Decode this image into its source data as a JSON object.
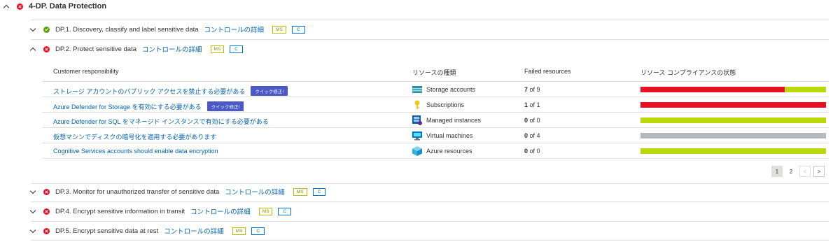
{
  "section": {
    "title": "4-DP. Data Protection"
  },
  "controls": [
    {
      "id": "dp1",
      "title": "DP.1. Discovery, classify and label sensitive data",
      "link": "コントロールの詳細",
      "badge_ms": "MS",
      "badge_c": "C",
      "status": "ok",
      "expanded": false
    },
    {
      "id": "dp2",
      "title": "DP.2. Protect sensitive data",
      "link": "コントロールの詳細",
      "badge_ms": "MS",
      "badge_c": "C",
      "status": "err",
      "expanded": true
    },
    {
      "id": "dp3",
      "title": "DP.3. Monitor for unauthorized transfer of sensitive data",
      "link": "コントロールの詳細",
      "badge_ms": "MS",
      "badge_c": "C",
      "status": "err",
      "expanded": false
    },
    {
      "id": "dp4",
      "title": "DP.4. Encrypt sensitive information in transit",
      "link": "コントロールの詳細",
      "badge_ms": "MS",
      "badge_c": "C",
      "status": "err",
      "expanded": false
    },
    {
      "id": "dp5",
      "title": "DP.5. Encrypt sensitive data at rest",
      "link": "コントロールの詳細",
      "badge_ms": "MS",
      "badge_c": "C",
      "status": "err",
      "expanded": false
    }
  ],
  "table": {
    "headers": {
      "responsibility": "Customer responsibility",
      "resource_type": "リソースの種類",
      "failed": "Failed resources",
      "compliance": "リソース コンプライアンスの状態"
    },
    "rows": [
      {
        "name": "ストレージ アカウントのパブリック アクセスを禁止する必要がある",
        "quickfix": "クイック修正!",
        "resource_type": "Storage accounts",
        "icon": "storage-icon",
        "failed": "7",
        "of": "of 9",
        "compliance": {
          "failed": 7,
          "passed": 2,
          "total": 9
        }
      },
      {
        "name": "Azure Defender for Storage を有効にする必要がある",
        "quickfix": "クイック修正!",
        "resource_type": "Subscriptions",
        "icon": "key-icon",
        "failed": "1",
        "of": "of 1",
        "compliance": {
          "failed": 1,
          "passed": 0,
          "total": 1
        }
      },
      {
        "name": "Azure Defender for SQL をマネージド インスタンスで有効にする必要がある",
        "quickfix": "",
        "resource_type": "Managed instances",
        "icon": "sql-icon",
        "failed": "0",
        "of": "of 0",
        "compliance": {
          "failed": 0,
          "passed": 1,
          "total": 1
        }
      },
      {
        "name": "仮想マシンでディスクの暗号化を適用する必要があります",
        "quickfix": "",
        "resource_type": "Virtual machines",
        "icon": "vm-icon",
        "failed": "0",
        "of": "of 4",
        "compliance": {
          "failed": 0,
          "passed": 0,
          "total": 4,
          "unknown": true
        }
      },
      {
        "name": "Cognitive Services accounts should enable data encryption",
        "quickfix": "",
        "resource_type": "Azure resources",
        "icon": "cube-icon",
        "failed": "0",
        "of": "of 0",
        "compliance": {
          "failed": 0,
          "passed": 1,
          "total": 1
        }
      }
    ],
    "pager": {
      "pages": [
        "1",
        "2"
      ],
      "current": "1",
      "prev": "<",
      "next": ">"
    }
  },
  "colors": {
    "failed": "#e81123",
    "passed": "#bad80a",
    "unknown": "#b3b9bf"
  }
}
